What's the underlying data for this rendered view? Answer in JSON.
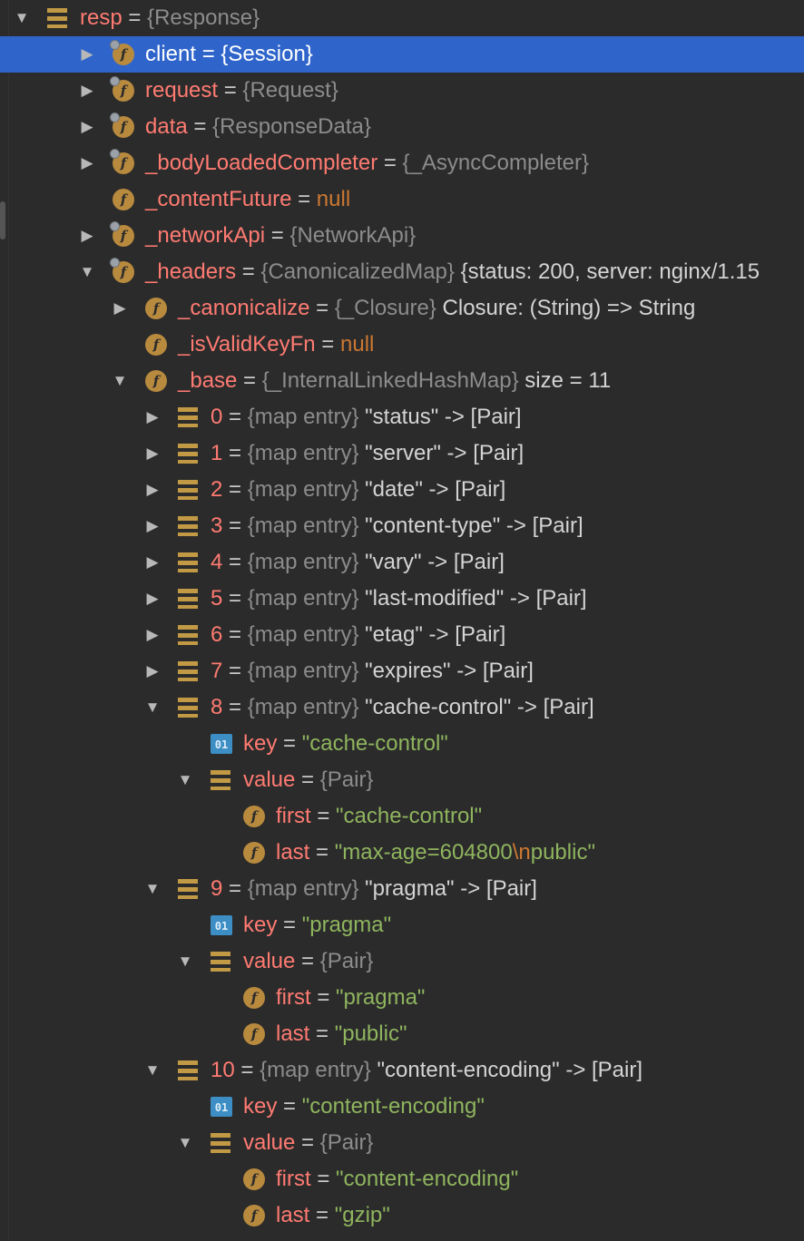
{
  "rows": [
    {
      "depth": 0,
      "arrow": "down",
      "icon": "stack",
      "lock": false,
      "name": "resp",
      "type": "{Response}",
      "value": "",
      "value_style": "plain"
    },
    {
      "depth": 1,
      "arrow": "right",
      "icon": "field",
      "lock": true,
      "name": "client",
      "type": "{Session}",
      "value": "",
      "value_style": "plain",
      "selected": true
    },
    {
      "depth": 1,
      "arrow": "right",
      "icon": "field",
      "lock": true,
      "name": "request",
      "type": "{Request}",
      "value": "",
      "value_style": "plain"
    },
    {
      "depth": 1,
      "arrow": "right",
      "icon": "field",
      "lock": true,
      "name": "data",
      "type": "{ResponseData}",
      "value": "",
      "value_style": "plain"
    },
    {
      "depth": 1,
      "arrow": "right",
      "icon": "field",
      "lock": true,
      "name": "_bodyLoadedCompleter",
      "type": "{_AsyncCompleter}",
      "value": "",
      "value_style": "plain"
    },
    {
      "depth": 1,
      "arrow": "none",
      "icon": "field",
      "lock": false,
      "name": "_contentFuture",
      "type": "",
      "value": "null",
      "value_style": "null"
    },
    {
      "depth": 1,
      "arrow": "right",
      "icon": "field",
      "lock": true,
      "name": "_networkApi",
      "type": "{NetworkApi}",
      "value": "",
      "value_style": "plain"
    },
    {
      "depth": 1,
      "arrow": "down",
      "icon": "field",
      "lock": true,
      "name": "_headers",
      "type": "{CanonicalizedMap}",
      "value": "{status: 200, server: nginx/1.15",
      "value_style": "plain"
    },
    {
      "depth": 2,
      "arrow": "right",
      "icon": "field",
      "lock": false,
      "name": "_canonicalize",
      "type": "{_Closure}",
      "value": "Closure: (String) => String",
      "value_style": "plain"
    },
    {
      "depth": 2,
      "arrow": "none",
      "icon": "field",
      "lock": false,
      "name": "_isValidKeyFn",
      "type": "",
      "value": "null",
      "value_style": "null"
    },
    {
      "depth": 2,
      "arrow": "down",
      "icon": "field",
      "lock": false,
      "name": "_base",
      "type": "{_InternalLinkedHashMap}",
      "value": "size = 11",
      "value_style": "plain"
    },
    {
      "depth": 3,
      "arrow": "right",
      "icon": "stack",
      "lock": false,
      "name": "0",
      "type": "{map entry}",
      "value": "\"status\" -> [Pair]",
      "value_style": "plain"
    },
    {
      "depth": 3,
      "arrow": "right",
      "icon": "stack",
      "lock": false,
      "name": "1",
      "type": "{map entry}",
      "value": "\"server\" -> [Pair]",
      "value_style": "plain"
    },
    {
      "depth": 3,
      "arrow": "right",
      "icon": "stack",
      "lock": false,
      "name": "2",
      "type": "{map entry}",
      "value": "\"date\" -> [Pair]",
      "value_style": "plain"
    },
    {
      "depth": 3,
      "arrow": "right",
      "icon": "stack",
      "lock": false,
      "name": "3",
      "type": "{map entry}",
      "value": "\"content-type\" -> [Pair]",
      "value_style": "plain"
    },
    {
      "depth": 3,
      "arrow": "right",
      "icon": "stack",
      "lock": false,
      "name": "4",
      "type": "{map entry}",
      "value": "\"vary\" -> [Pair]",
      "value_style": "plain"
    },
    {
      "depth": 3,
      "arrow": "right",
      "icon": "stack",
      "lock": false,
      "name": "5",
      "type": "{map entry}",
      "value": "\"last-modified\" -> [Pair]",
      "value_style": "plain"
    },
    {
      "depth": 3,
      "arrow": "right",
      "icon": "stack",
      "lock": false,
      "name": "6",
      "type": "{map entry}",
      "value": "\"etag\" -> [Pair]",
      "value_style": "plain"
    },
    {
      "depth": 3,
      "arrow": "right",
      "icon": "stack",
      "lock": false,
      "name": "7",
      "type": "{map entry}",
      "value": "\"expires\" -> [Pair]",
      "value_style": "plain"
    },
    {
      "depth": 3,
      "arrow": "down",
      "icon": "stack",
      "lock": false,
      "name": "8",
      "type": "{map entry}",
      "value": "\"cache-control\" -> [Pair]",
      "value_style": "plain"
    },
    {
      "depth": 4,
      "arrow": "none",
      "icon": "prim",
      "lock": false,
      "name": "key",
      "type": "",
      "value": "\"cache-control\"",
      "value_style": "str"
    },
    {
      "depth": 4,
      "arrow": "down",
      "icon": "stack",
      "lock": false,
      "name": "value",
      "type": "{Pair}",
      "value": "",
      "value_style": "plain"
    },
    {
      "depth": 5,
      "arrow": "none",
      "icon": "field",
      "lock": false,
      "name": "first",
      "type": "",
      "value": "\"cache-control\"",
      "value_style": "str"
    },
    {
      "depth": 5,
      "arrow": "none",
      "icon": "field",
      "lock": false,
      "name": "last",
      "type": "",
      "value": "\"max-age=604800",
      "value2": "\\n",
      "value3": "public\"",
      "value_style": "str-esc"
    },
    {
      "depth": 3,
      "arrow": "down",
      "icon": "stack",
      "lock": false,
      "name": "9",
      "type": "{map entry}",
      "value": "\"pragma\" -> [Pair]",
      "value_style": "plain"
    },
    {
      "depth": 4,
      "arrow": "none",
      "icon": "prim",
      "lock": false,
      "name": "key",
      "type": "",
      "value": "\"pragma\"",
      "value_style": "str"
    },
    {
      "depth": 4,
      "arrow": "down",
      "icon": "stack",
      "lock": false,
      "name": "value",
      "type": "{Pair}",
      "value": "",
      "value_style": "plain"
    },
    {
      "depth": 5,
      "arrow": "none",
      "icon": "field",
      "lock": false,
      "name": "first",
      "type": "",
      "value": "\"pragma\"",
      "value_style": "str"
    },
    {
      "depth": 5,
      "arrow": "none",
      "icon": "field",
      "lock": false,
      "name": "last",
      "type": "",
      "value": "\"public\"",
      "value_style": "str"
    },
    {
      "depth": 3,
      "arrow": "down",
      "icon": "stack",
      "lock": false,
      "name": "10",
      "type": "{map entry}",
      "value": "\"content-encoding\" -> [Pair]",
      "value_style": "plain"
    },
    {
      "depth": 4,
      "arrow": "none",
      "icon": "prim",
      "lock": false,
      "name": "key",
      "type": "",
      "value": "\"content-encoding\"",
      "value_style": "str"
    },
    {
      "depth": 4,
      "arrow": "down",
      "icon": "stack",
      "lock": false,
      "name": "value",
      "type": "{Pair}",
      "value": "",
      "value_style": "plain"
    },
    {
      "depth": 5,
      "arrow": "none",
      "icon": "field",
      "lock": false,
      "name": "first",
      "type": "",
      "value": "\"content-encoding\"",
      "value_style": "str"
    },
    {
      "depth": 5,
      "arrow": "none",
      "icon": "field",
      "lock": false,
      "name": "last",
      "type": "",
      "value": "\"gzip\"",
      "value_style": "str"
    }
  ],
  "icon_labels": {
    "field": "f",
    "prim": "01"
  },
  "equals": "=",
  "colors": {
    "background": "#2b2b2b",
    "selection": "#2f65ca",
    "name": "#ff7b72",
    "string": "#8fb55e",
    "keyword": "#cc7832",
    "type": "#8c8c8c"
  }
}
